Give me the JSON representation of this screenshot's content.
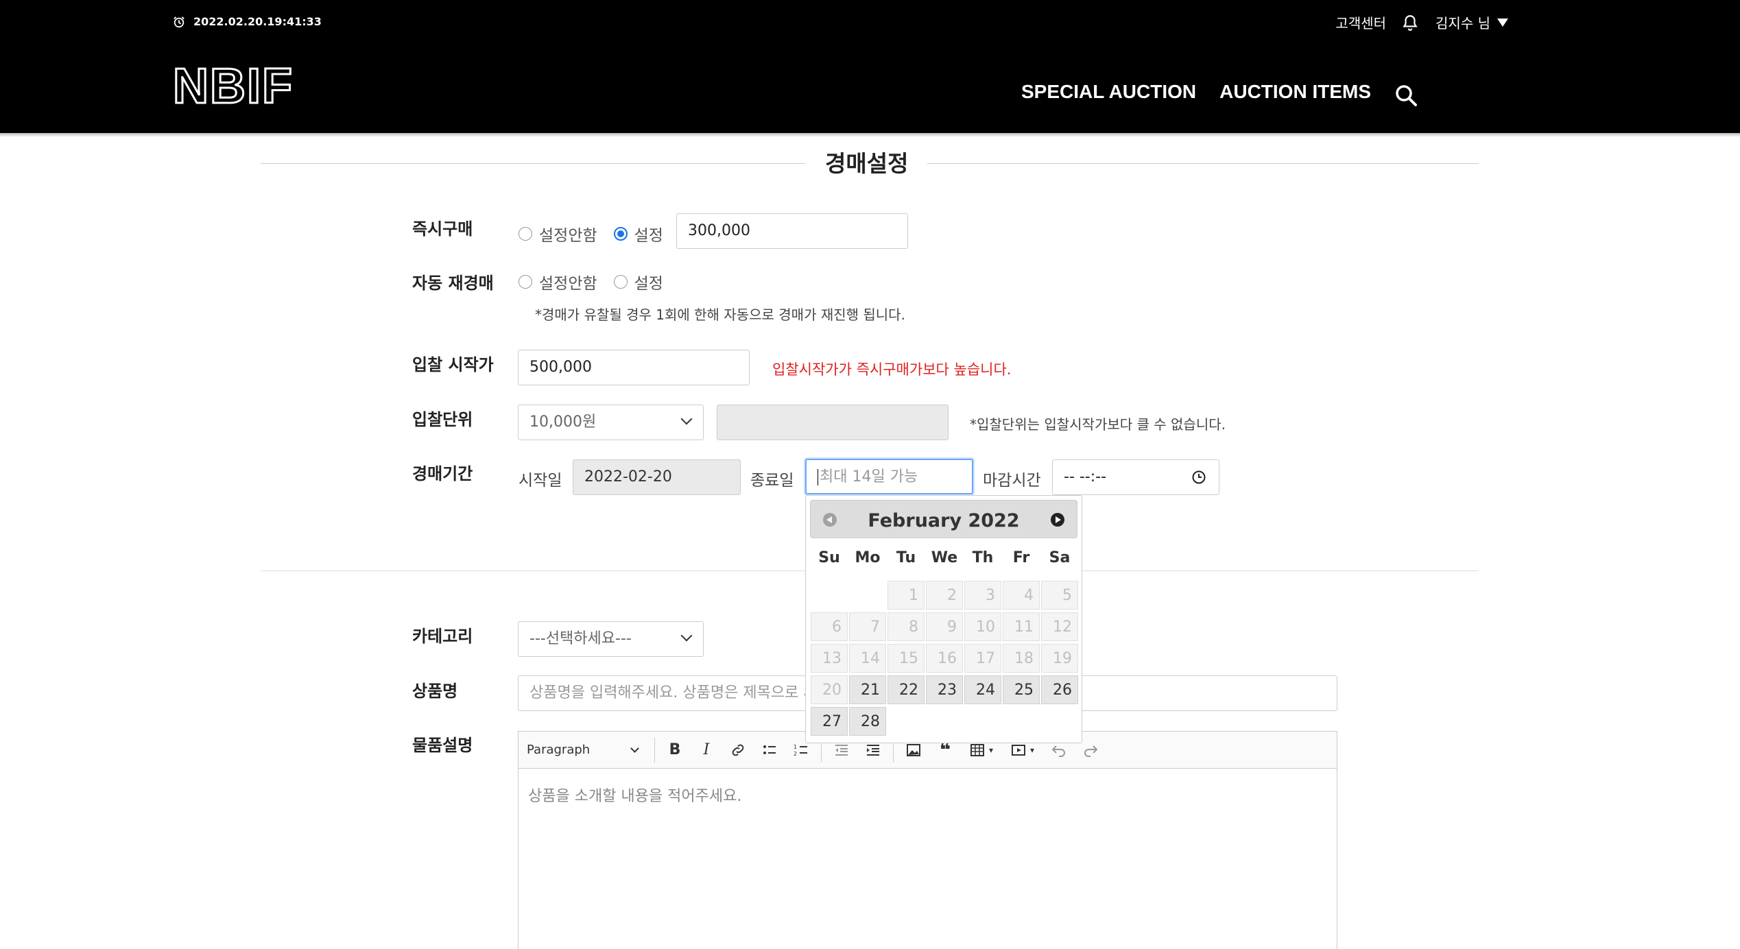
{
  "header": {
    "datetime": "2022.02.20.19:41:33",
    "customer_center": "고객센터",
    "user_name": "김지수 님",
    "logo": "NBIF",
    "nav": [
      "SPECIAL AUCTION",
      "AUCTION ITEMS"
    ]
  },
  "section_title": "경매설정",
  "buy_now": {
    "label": "즉시구매",
    "options": [
      "설정안함",
      "설정"
    ],
    "selected": "설정",
    "value": "300,000"
  },
  "auto_relist": {
    "label": "자동 재경매",
    "options": [
      "설정안함",
      "설정"
    ],
    "note": "*경매가 유찰될 경우 1회에 한해 자동으로 경매가 재진행 됩니다."
  },
  "start_price": {
    "label": "입찰 시작가",
    "value": "500,000",
    "error": "입찰시작가가 즉시구매가보다 높습니다."
  },
  "bid_unit": {
    "label": "입찰단위",
    "selected": "10,000원",
    "custom_value": "",
    "note": "*입찰단위는 입찰시작가보다 클 수 없습니다."
  },
  "auction_period": {
    "label": "경매기간",
    "start_label": "시작일",
    "start_value": "2022-02-20",
    "end_label": "종료일",
    "end_placeholder": "최대 14일 가능",
    "deadline_label": "마감시간",
    "deadline_value": "-- --:--"
  },
  "datepicker": {
    "title": "February 2022",
    "weekdays": [
      "Su",
      "Mo",
      "Tu",
      "We",
      "Th",
      "Fr",
      "Sa"
    ],
    "first_weekday_index": 2,
    "days_in_month": 28,
    "first_selectable_day": 21
  },
  "category": {
    "label": "카테고리",
    "selected": "---선택하세요---"
  },
  "product_name": {
    "label": "상품명",
    "placeholder": "상품명을 입력해주세요. 상품명은 제목으로 사용됩니다."
  },
  "description": {
    "label": "물품설명",
    "paragraph_format": "Paragraph",
    "placeholder": "상품을 소개할 내용을 적어주세요."
  },
  "colors": {
    "header_bg": "#000000",
    "radio_accent": "#1a73e8",
    "error_text": "#e02020"
  }
}
